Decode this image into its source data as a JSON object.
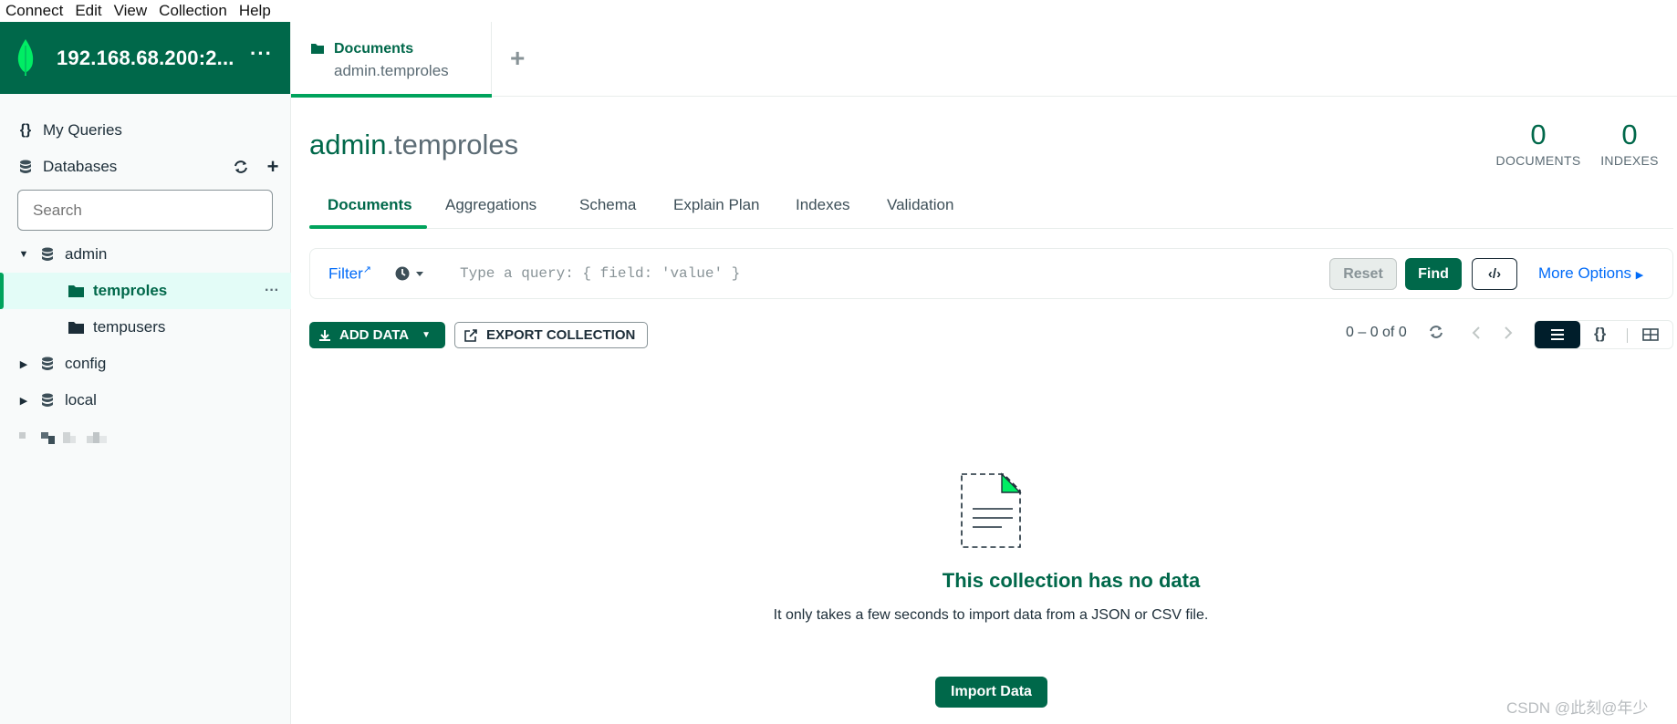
{
  "menu": [
    "Connect",
    "Edit",
    "View",
    "Collection",
    "Help"
  ],
  "connection": {
    "name": "192.168.68.200:2...",
    "more": "···"
  },
  "sidebar": {
    "my_queries": "My Queries",
    "databases": "Databases",
    "search_placeholder": "Search",
    "tree": [
      {
        "label": "admin",
        "expanded": true,
        "children": [
          "temproles",
          "tempusers"
        ],
        "selected": "temproles"
      },
      {
        "label": "config",
        "expanded": false
      },
      {
        "label": "local",
        "expanded": false
      }
    ]
  },
  "tab": {
    "title": "Documents",
    "subtitle": "admin.temproles",
    "add": "+"
  },
  "header": {
    "db": "admin",
    "coll": ".temproles",
    "documents_count": "0",
    "documents_label": "DOCUMENTS",
    "indexes_count": "0",
    "indexes_label": "INDEXES"
  },
  "subtabs": [
    "Documents",
    "Aggregations",
    "Schema",
    "Explain Plan",
    "Indexes",
    "Validation"
  ],
  "query": {
    "filter_label": "Filter",
    "placeholder": "Type a query: { field: 'value' }",
    "reset": "Reset",
    "find": "Find",
    "more_options": "More Options"
  },
  "toolbar": {
    "add_data": "ADD DATA",
    "export": "EXPORT COLLECTION",
    "range": "0 – 0 of 0"
  },
  "empty": {
    "title": "This collection has no data",
    "desc": "It only takes a few seconds to import data from a JSON or CSV file.",
    "import": "Import Data"
  },
  "watermark": "CSDN @此刻@年少",
  "colors": {
    "brand": "#00684a",
    "accent": "#00a35c",
    "link": "#016bf8"
  }
}
